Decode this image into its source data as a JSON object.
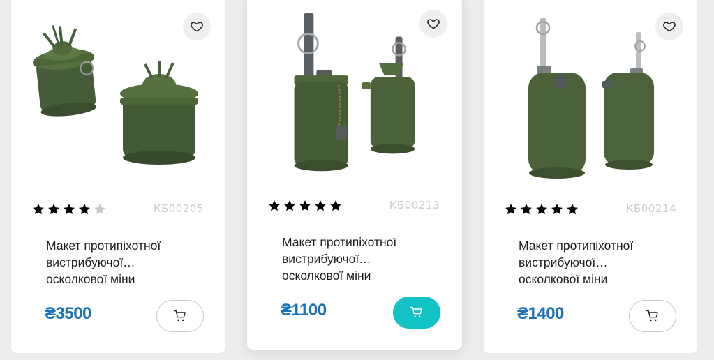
{
  "colors": {
    "price": "#1a73b8",
    "cart_active": "#13c2c4",
    "star_filled": "#000000",
    "star_empty": "#c8cbcd",
    "sku": "#c9ccd0"
  },
  "products": [
    {
      "sku": "КБ00205",
      "rating": 4,
      "max_rating": 5,
      "title_lines": [
        "Макет протипіхотної",
        "вистрибуючої…",
        "осколкової міни"
      ],
      "price": "₴3500",
      "cart_icon": "cart-icon",
      "cart_active": false
    },
    {
      "sku": "КБ00213",
      "rating": 5,
      "max_rating": 5,
      "title_lines": [
        "Макет протипіхотної",
        "вистрибуючої…",
        "осколкової міни"
      ],
      "price": "₴1100",
      "cart_icon": "cart-icon",
      "cart_active": true
    },
    {
      "sku": "КБ00214",
      "rating": 5,
      "max_rating": 5,
      "title_lines": [
        "Макет протипіхотної",
        "вистрибуючої…",
        "осколкової міни"
      ],
      "price": "₴1400",
      "cart_icon": "cart-icon",
      "cart_active": false
    }
  ]
}
